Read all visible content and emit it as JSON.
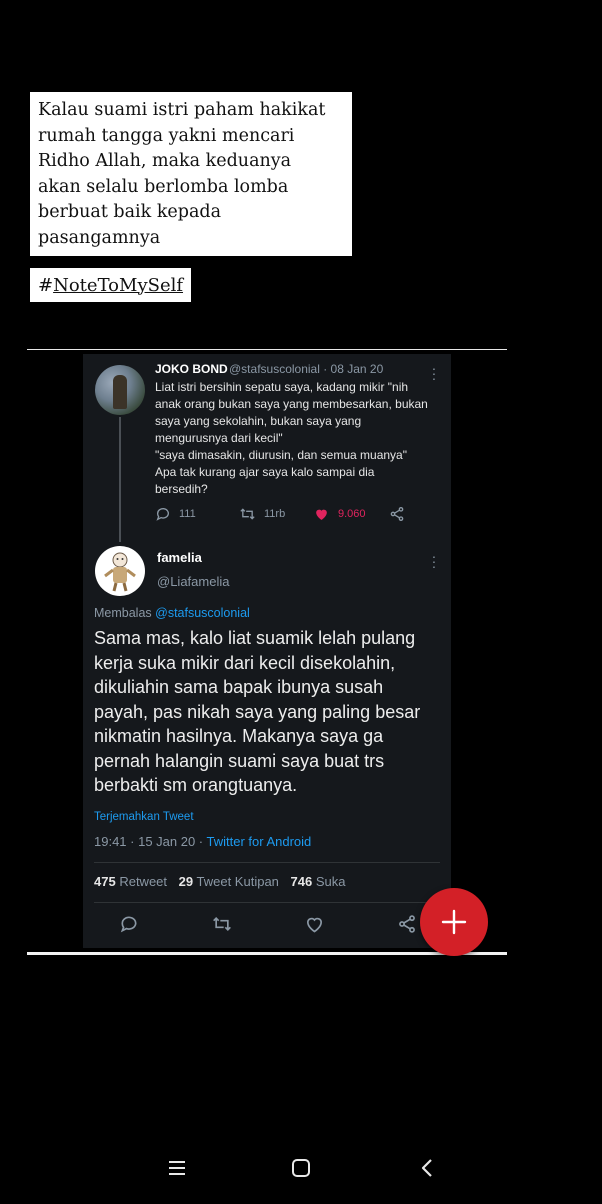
{
  "quote": {
    "text": "Kalau suami istri paham hakikat\nrumah tangga yakni mencari\nRidho Allah, maka keduanya\nakan selalu berlomba lomba\nberbuat baik kepada\npasangamnya",
    "hashtag_symbol": "#",
    "hashtag_text": "NoteToMySelf"
  },
  "tweet1": {
    "name": "JOKO BOND",
    "handle": "@stafsuscolonial · 08 Jan 20",
    "text": "Liat istri bersihin sepatu saya, kadang mikir \"nih\nanak orang bukan saya yang membesarkan, bukan\nsaya yang sekolahin, bukan saya yang\nmengurusnya dari kecil\"\n\"saya dimasakin, diurusin, dan semua muanya\"\nApa tak kurang ajar saya kalo sampai dia\nbersedih?",
    "replies": "111",
    "retweets": "11rb",
    "likes": "9.060",
    "icons": [
      "reply-icon",
      "retweet-icon",
      "heart-icon",
      "share-icon"
    ],
    "like_color": "#e0245e"
  },
  "tweet2": {
    "name": "famelia",
    "handle": "@Liafamelia",
    "reply_prefix": "Membalas ",
    "reply_handle": "@stafsuscolonial",
    "text": "Sama mas, kalo liat suamik lelah pulang\nkerja suka mikir dari kecil disekolahin,\ndikuliahin sama bapak ibunya susah\npayah, pas nikah saya yang paling besar\nnikmatin hasilnya. Makanya saya ga\npernah halangin suami saya buat trs\nberbakti sm orangtuanya.",
    "translate": "Terjemahkan Tweet",
    "time": "19:41 · 15 Jan 20 · ",
    "client": "Twitter for Android",
    "stats": {
      "retweet_count": "475",
      "retweet_label": "Retweet",
      "quote_count": "29",
      "quote_label": "Tweet Kutipan",
      "like_count": "746",
      "like_label": "Suka"
    }
  },
  "fab": {
    "icon": "plus-icon",
    "color": "#d32027"
  },
  "navbar": {
    "icons": [
      "recents-icon",
      "home-icon",
      "back-icon"
    ]
  },
  "colors": {
    "background": "#000000",
    "panel": "#15181c",
    "link": "#1d9bf0",
    "muted": "#8b98a5"
  }
}
